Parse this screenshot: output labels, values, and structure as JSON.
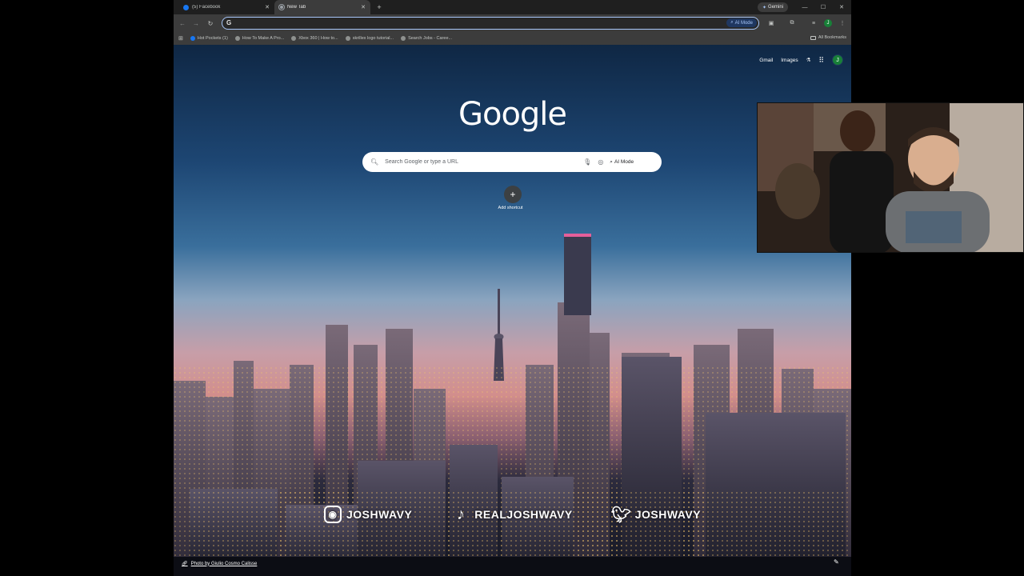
{
  "tabs": [
    {
      "title": "(5) Facebook",
      "active": false,
      "icon": "facebook-icon"
    },
    {
      "title": "New Tab",
      "active": true,
      "icon": "chrome-icon"
    }
  ],
  "gemini_label": "Gemini",
  "omnibox": {
    "value": "",
    "ai_mode_label": "AI Mode"
  },
  "bookmarks": [
    {
      "label": "Hot Pockets (1)",
      "icon": "facebook-icon"
    },
    {
      "label": "How To Make A Pro...",
      "icon": "globe-icon"
    },
    {
      "label": "Xbox 360 | How to...",
      "icon": "globe-icon"
    },
    {
      "label": "skrillex logo tutorial...",
      "icon": "globe-icon"
    },
    {
      "label": "Search Jobs - Caree...",
      "icon": "globe-icon"
    }
  ],
  "all_bookmarks_label": "All Bookmarks",
  "ntp": {
    "gmail": "Gmail",
    "images": "Images",
    "avatar_letter": "J",
    "logo": "Google",
    "search_placeholder": "Search Google or type a URL",
    "ai_mode": "AI Mode",
    "add_shortcut": "Add shortcut",
    "photo_credit": "Photo by Giulio Cosmo Calisse"
  },
  "socials": [
    {
      "platform": "instagram",
      "handle": "JOSHWAVY"
    },
    {
      "platform": "tiktok",
      "handle": "REALJOSHWAVY"
    },
    {
      "platform": "twitter",
      "handle": "JOSHWAVY"
    }
  ]
}
